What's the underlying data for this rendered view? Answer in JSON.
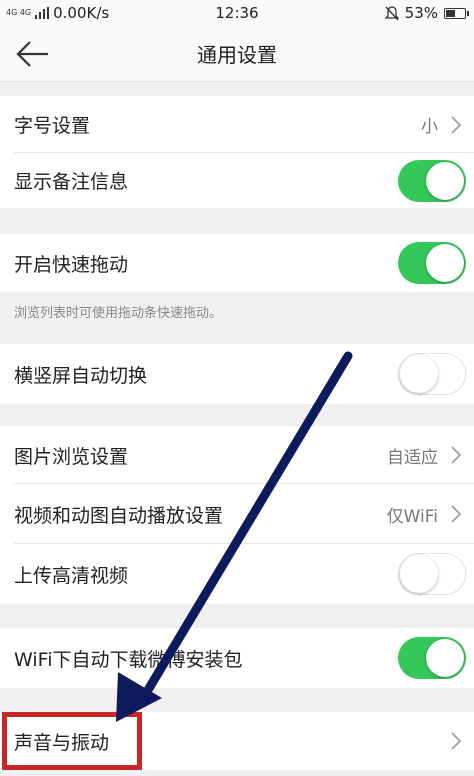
{
  "status_bar": {
    "network": "4G 4G",
    "speed": "0.00K/s",
    "time": "12:36",
    "battery": "53%",
    "battery_level": 0.53
  },
  "nav": {
    "title": "通用设置"
  },
  "settings": {
    "font_size": {
      "label": "字号设置",
      "value": "小"
    },
    "show_remark": {
      "label": "显示备注信息",
      "on": true
    },
    "fast_drag": {
      "label": "开启快速拖动",
      "on": true,
      "hint": "浏览列表时可使用拖动条快速拖动。"
    },
    "auto_rotate": {
      "label": "横竖屏自动切换",
      "on": false
    },
    "image_browse": {
      "label": "图片浏览设置",
      "value": "自适应"
    },
    "autoplay": {
      "label": "视频和动图自动播放设置",
      "value": "仅WiFi"
    },
    "hd_upload": {
      "label": "上传高清视频",
      "on": false
    },
    "wifi_download": {
      "label": "WiFi下自动下载微博安装包",
      "on": true
    },
    "sound": {
      "label": "声音与振动"
    }
  },
  "colors": {
    "toggle_on": "#34c759",
    "highlight": "#c62828",
    "arrow": "#0d1a5e"
  }
}
